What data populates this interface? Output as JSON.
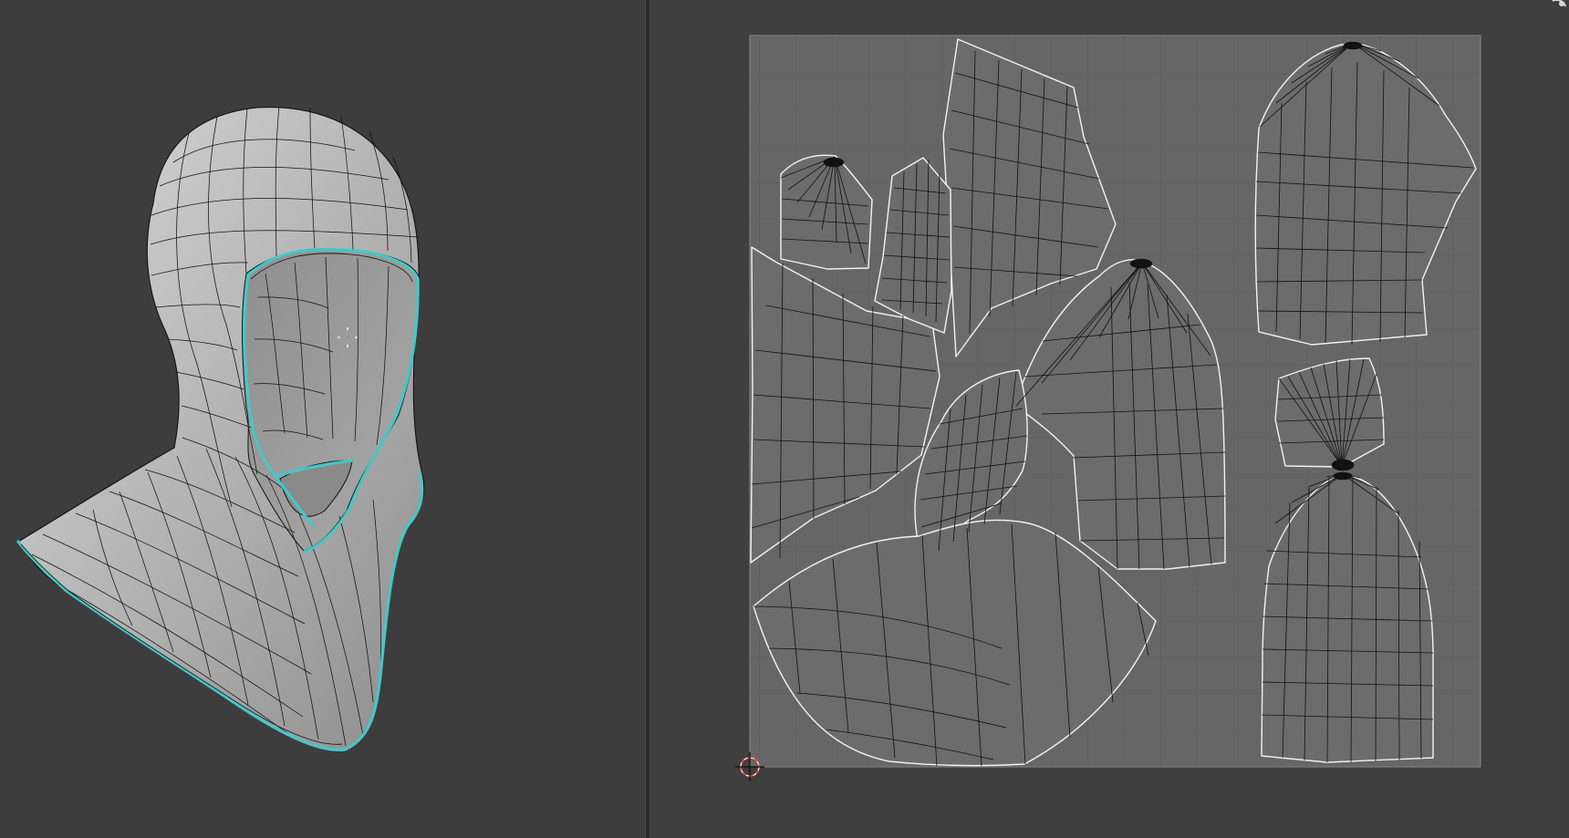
{
  "app": {
    "name": "",
    "accent": "#42c8c8",
    "viewport_bg": "#3d3d3d",
    "uv_bg": "#3f3f3f",
    "uv_tile_fill": "#707070",
    "mesh_fill": "#b9b9b9",
    "wire_color": "#111111",
    "seam_color": "#45c7c8"
  },
  "viewport_3d": {
    "object": "hood-mesh",
    "cursor_icon": "3d-cursor-crosshair-icon",
    "selection_outline": "cyan-seam-edges"
  },
  "uv_editor": {
    "tile": "uv-0-1-space",
    "origin_icon": "2d-cursor-icon",
    "islands": [
      "back-panel-top",
      "side-panel-left",
      "side-panel-right",
      "front-hood-panel",
      "neck-gusset",
      "shoulder-cape",
      "crown-fan-left",
      "crown-fan-right",
      "lower-back-panel"
    ]
  },
  "corner_widget": {
    "icon": "corner-widget-icon"
  }
}
